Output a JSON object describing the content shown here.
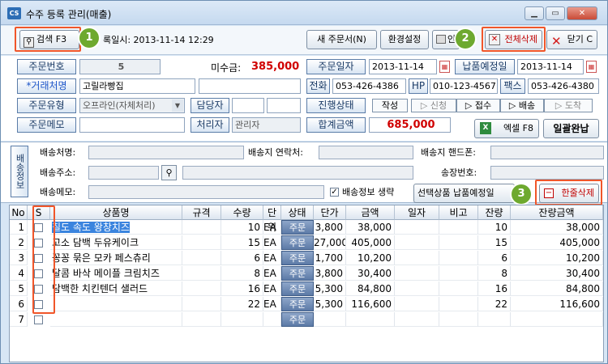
{
  "window": {
    "title": "수주 등록 관리(매출)",
    "icon": "CS",
    "min": "▁",
    "max": "▭",
    "close": "✕"
  },
  "toolbar": {
    "search_label": "검색 F3",
    "reg_datetime": "록일시: 2013-11-14 12:29",
    "new_order_label": "새 주문서(N)",
    "env_label": "환경설정",
    "print_label": "인",
    "delete_all_label": "전체삭제",
    "close_label": "닫기 C",
    "callouts": [
      "1",
      "2",
      "3"
    ]
  },
  "form": {
    "order_no_label": "주문번호",
    "order_no": "5",
    "unpaid_label": "미수금:",
    "unpaid": "385,000",
    "order_date_label": "주문일자",
    "order_date": "2013-11-14",
    "due_date_label": "납품예정일",
    "due_date": "2013-11-14",
    "client_label": "*거래처명",
    "client": "고릴라빵집",
    "client_extra": "",
    "phone_label": "전화",
    "phone": "053-426-4386",
    "hp_label": "HP",
    "hp": "010-123-4567",
    "fax_label": "팩스",
    "fax": "053-426-4380",
    "order_type_label": "주문유형",
    "order_type": "오프라인(자체처리)",
    "manager_label": "담당자",
    "status_label": "진행상태",
    "status_steps": [
      "작성",
      "신청",
      "접수",
      "배송",
      "도착"
    ],
    "memo_label": "주문메모",
    "processor_label": "처리자",
    "processor": "관리자",
    "total_label": "합계금액",
    "total": "685,000",
    "excel_label": "엑셀 F8",
    "complete_label": "일괄완납"
  },
  "shipping": {
    "section_label": "배송정보",
    "name_label": "배송처명:",
    "contact_label": "배송지 연락처:",
    "mobile_label": "배송지 핸드폰:",
    "address_label": "배송주소:",
    "invoice_label": "송장번호:",
    "memo_label": "배송메모:",
    "omit_label": "배송정보 생략",
    "due_selected_label": "선택상품 납품예정일",
    "delete_row_label": "한줄삭제"
  },
  "grid": {
    "columns": [
      "No",
      "S",
      "상품명",
      "규격",
      "수량",
      "단위",
      "상태",
      "단가",
      "금액",
      "일자",
      "비고",
      "잔량",
      "잔량금액"
    ],
    "rows": [
      {
        "no": "1",
        "name": "칠도 속도 왕창치즈",
        "spec": "",
        "qty": "10",
        "unit": "EA",
        "status": "주문",
        "price": "3,800",
        "amount": "38,000",
        "date": "",
        "note": "",
        "remain": "10",
        "remain_amount": "38,000"
      },
      {
        "no": "2",
        "name": "고소 담백 두유케이크",
        "spec": "",
        "qty": "15",
        "unit": "EA",
        "status": "주문",
        "price": "27,000",
        "amount": "405,000",
        "date": "",
        "note": "",
        "remain": "15",
        "remain_amount": "405,000"
      },
      {
        "no": "3",
        "name": "꽁꽁 묶은 모카 페스츄리",
        "spec": "",
        "qty": "6",
        "unit": "EA",
        "status": "주문",
        "price": "1,700",
        "amount": "10,200",
        "date": "",
        "note": "",
        "remain": "6",
        "remain_amount": "10,200"
      },
      {
        "no": "4",
        "name": "달콤 바삭 메이플 크림치즈",
        "spec": "",
        "qty": "8",
        "unit": "EA",
        "status": "주문",
        "price": "3,800",
        "amount": "30,400",
        "date": "",
        "note": "",
        "remain": "8",
        "remain_amount": "30,400"
      },
      {
        "no": "5",
        "name": "담백한 치킨텐더 샐러드",
        "spec": "",
        "qty": "16",
        "unit": "EA",
        "status": "주문",
        "price": "5,300",
        "amount": "84,800",
        "date": "",
        "note": "",
        "remain": "16",
        "remain_amount": "84,800"
      },
      {
        "no": "6",
        "name": "",
        "spec": "",
        "qty": "22",
        "unit": "EA",
        "status": "주문",
        "price": "5,300",
        "amount": "116,600",
        "date": "",
        "note": "",
        "remain": "22",
        "remain_amount": "116,600"
      },
      {
        "no": "7",
        "name": "",
        "spec": "",
        "qty": "",
        "unit": "",
        "status": "주문",
        "price": "",
        "amount": "",
        "date": "",
        "note": "",
        "remain": "",
        "remain_amount": ""
      }
    ]
  },
  "colors": {
    "accent": "#f0562a",
    "callout": "#6ea92f",
    "unpaid": "#d00000",
    "selection": "#3a84de"
  }
}
